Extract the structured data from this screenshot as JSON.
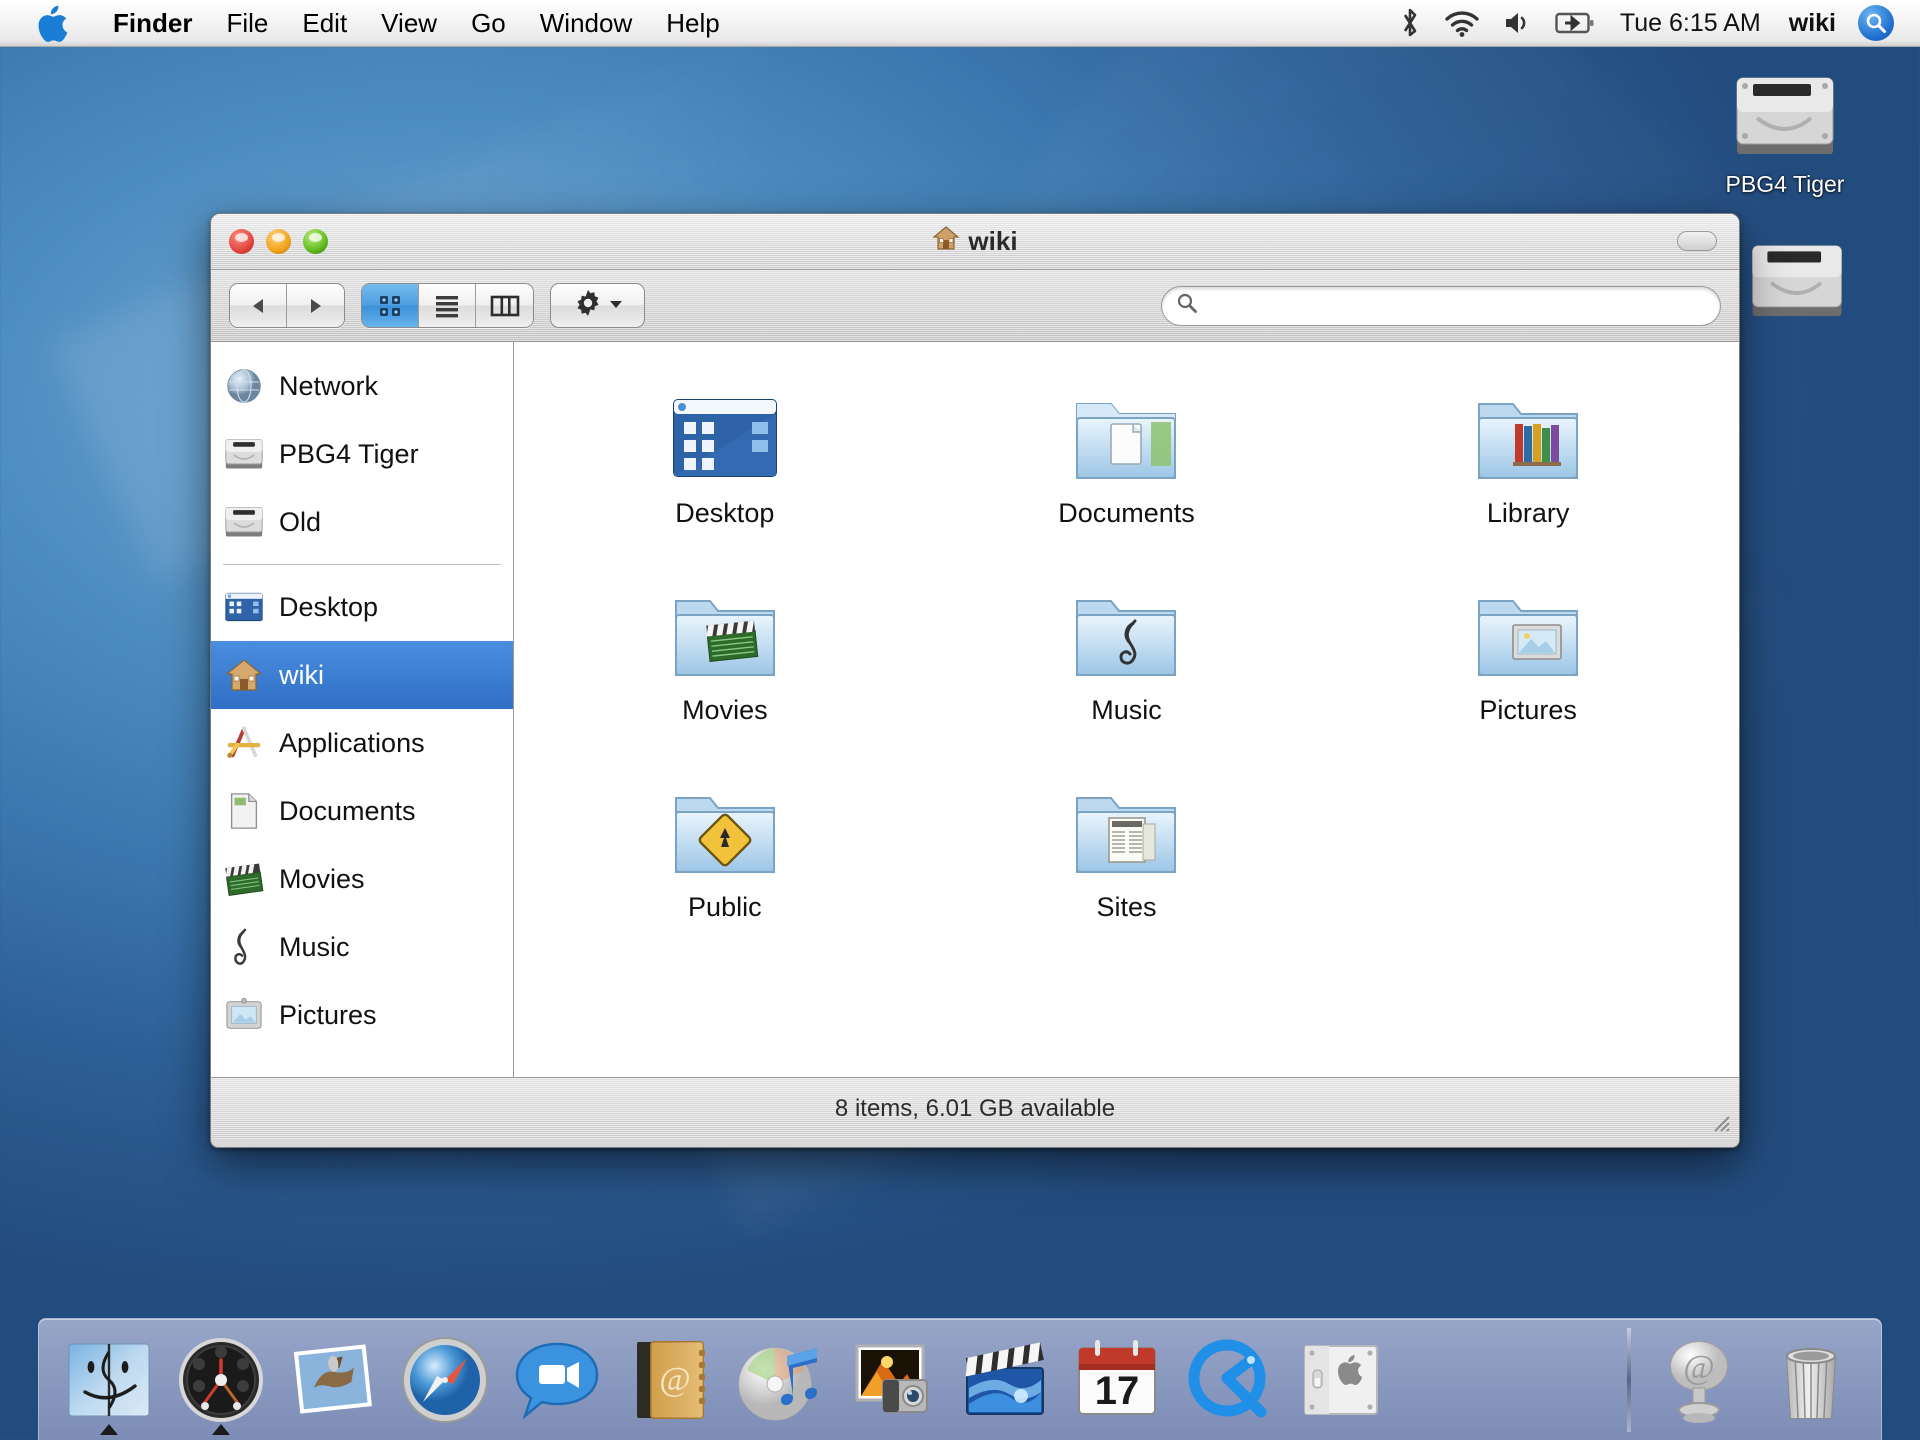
{
  "menubar": {
    "apple_icon": "apple-logo-icon",
    "items": [
      {
        "label": "Finder",
        "bold": true
      },
      {
        "label": "File",
        "bold": false
      },
      {
        "label": "Edit",
        "bold": false
      },
      {
        "label": "View",
        "bold": false
      },
      {
        "label": "Go",
        "bold": false
      },
      {
        "label": "Window",
        "bold": false
      },
      {
        "label": "Help",
        "bold": false
      }
    ],
    "status_icons": [
      "bluetooth-icon",
      "wifi-icon",
      "volume-icon",
      "battery-icon"
    ],
    "clock": "Tue 6:15 AM",
    "user": "wiki",
    "spotlight_icon": "spotlight-search-icon"
  },
  "desktop": {
    "icons": [
      {
        "label": "PBG4 Tiger",
        "icon": "hard-drive-icon"
      },
      {
        "label": "",
        "icon": "hard-drive-icon"
      }
    ]
  },
  "window": {
    "title": "wiki",
    "title_icon": "home-icon",
    "traffic_lights": [
      "close",
      "minimize",
      "zoom"
    ],
    "toolbar": {
      "back_label": "Back",
      "forward_label": "Forward",
      "view_modes": [
        {
          "name": "icon-view",
          "label": "Icon View",
          "active": true
        },
        {
          "name": "list-view",
          "label": "List View",
          "active": false
        },
        {
          "name": "column-view",
          "label": "Column View",
          "active": false
        }
      ],
      "action_label": "Action",
      "search_placeholder": "",
      "search_value": ""
    },
    "sidebar": {
      "groups": [
        {
          "items": [
            {
              "label": "Network",
              "icon": "network-globe-icon",
              "selected": false
            },
            {
              "label": "PBG4 Tiger",
              "icon": "hard-drive-icon",
              "selected": false
            },
            {
              "label": "Old",
              "icon": "hard-drive-icon",
              "selected": false
            }
          ]
        },
        {
          "items": [
            {
              "label": "Desktop",
              "icon": "desktop-icon",
              "selected": false
            },
            {
              "label": "wiki",
              "icon": "home-icon",
              "selected": true
            },
            {
              "label": "Applications",
              "icon": "applications-icon",
              "selected": false
            },
            {
              "label": "Documents",
              "icon": "documents-icon",
              "selected": false
            },
            {
              "label": "Movies",
              "icon": "movies-clapper-icon",
              "selected": false
            },
            {
              "label": "Music",
              "icon": "music-note-icon",
              "selected": false
            },
            {
              "label": "Pictures",
              "icon": "pictures-frame-icon",
              "selected": false
            }
          ]
        }
      ]
    },
    "files": [
      {
        "label": "Desktop",
        "icon": "desktop-folder-icon"
      },
      {
        "label": "Documents",
        "icon": "documents-folder-icon"
      },
      {
        "label": "Library",
        "icon": "library-folder-icon"
      },
      {
        "label": "Movies",
        "icon": "movies-folder-icon"
      },
      {
        "label": "Music",
        "icon": "music-folder-icon"
      },
      {
        "label": "Pictures",
        "icon": "pictures-folder-icon"
      },
      {
        "label": "Public",
        "icon": "public-folder-icon"
      },
      {
        "label": "Sites",
        "icon": "sites-folder-icon"
      }
    ],
    "status": "8 items, 6.01 GB available"
  },
  "dock": {
    "left_items": [
      {
        "label": "Finder",
        "icon": "finder-icon",
        "running": true
      },
      {
        "label": "Dashboard",
        "icon": "dashboard-icon",
        "running": true
      },
      {
        "label": "Mail",
        "icon": "mail-icon",
        "running": false
      },
      {
        "label": "Safari",
        "icon": "safari-icon",
        "running": false
      },
      {
        "label": "iChat",
        "icon": "ichat-icon",
        "running": false
      },
      {
        "label": "Address Book",
        "icon": "address-book-icon",
        "running": false
      },
      {
        "label": "iTunes",
        "icon": "itunes-icon",
        "running": false
      },
      {
        "label": "iPhoto",
        "icon": "iphoto-icon",
        "running": false
      },
      {
        "label": "iMovie",
        "icon": "imovie-icon",
        "running": false
      },
      {
        "label": "iCal",
        "icon": "ical-icon",
        "running": false,
        "badge": "17"
      },
      {
        "label": "QuickTime Player",
        "icon": "quicktime-icon",
        "running": false
      },
      {
        "label": "System Preferences",
        "icon": "system-preferences-icon",
        "running": false
      }
    ],
    "right_items": [
      {
        "label": "Internet",
        "icon": "at-sign-icon",
        "running": false
      },
      {
        "label": "Trash",
        "icon": "trash-icon",
        "running": false
      }
    ],
    "ical_day": "17"
  },
  "colors": {
    "selection_blue": "#3b7fd4",
    "desktop_blue": "#3f7db4",
    "dock_blue": "#8e9ecb"
  }
}
